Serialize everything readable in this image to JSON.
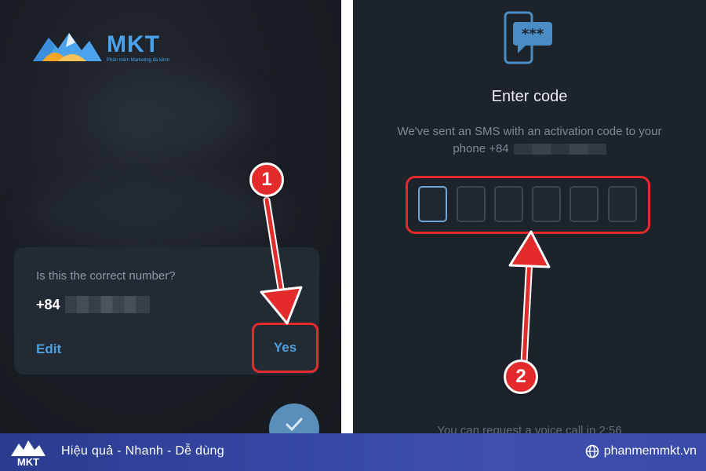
{
  "brand": {
    "name": "MKT",
    "subtitle": "Phần mềm Marketing đa kênh",
    "colors": {
      "primary": "#4aa3ec",
      "accent_orange": "#f5a524",
      "banner": "#3547a3"
    }
  },
  "confirm_dialog": {
    "question": "Is this the correct number?",
    "phone_prefix": "+84",
    "edit_label": "Edit",
    "yes_label": "Yes"
  },
  "fab": {
    "icon": "check-icon"
  },
  "verify_screen": {
    "title": "Enter code",
    "description": "We've sent an SMS with an activation code to your",
    "phone_label": "phone +84",
    "code_boxes": [
      "",
      "",
      "",
      "",
      "",
      ""
    ],
    "voice_call_text": "You can request a voice call in 2:56"
  },
  "markers": {
    "step1": "1",
    "step2": "2"
  },
  "banner": {
    "tagline": "Hiệu quả - Nhanh  - Dễ dùng",
    "website": "phanmemmkt.vn",
    "logo_text": "MKT"
  }
}
